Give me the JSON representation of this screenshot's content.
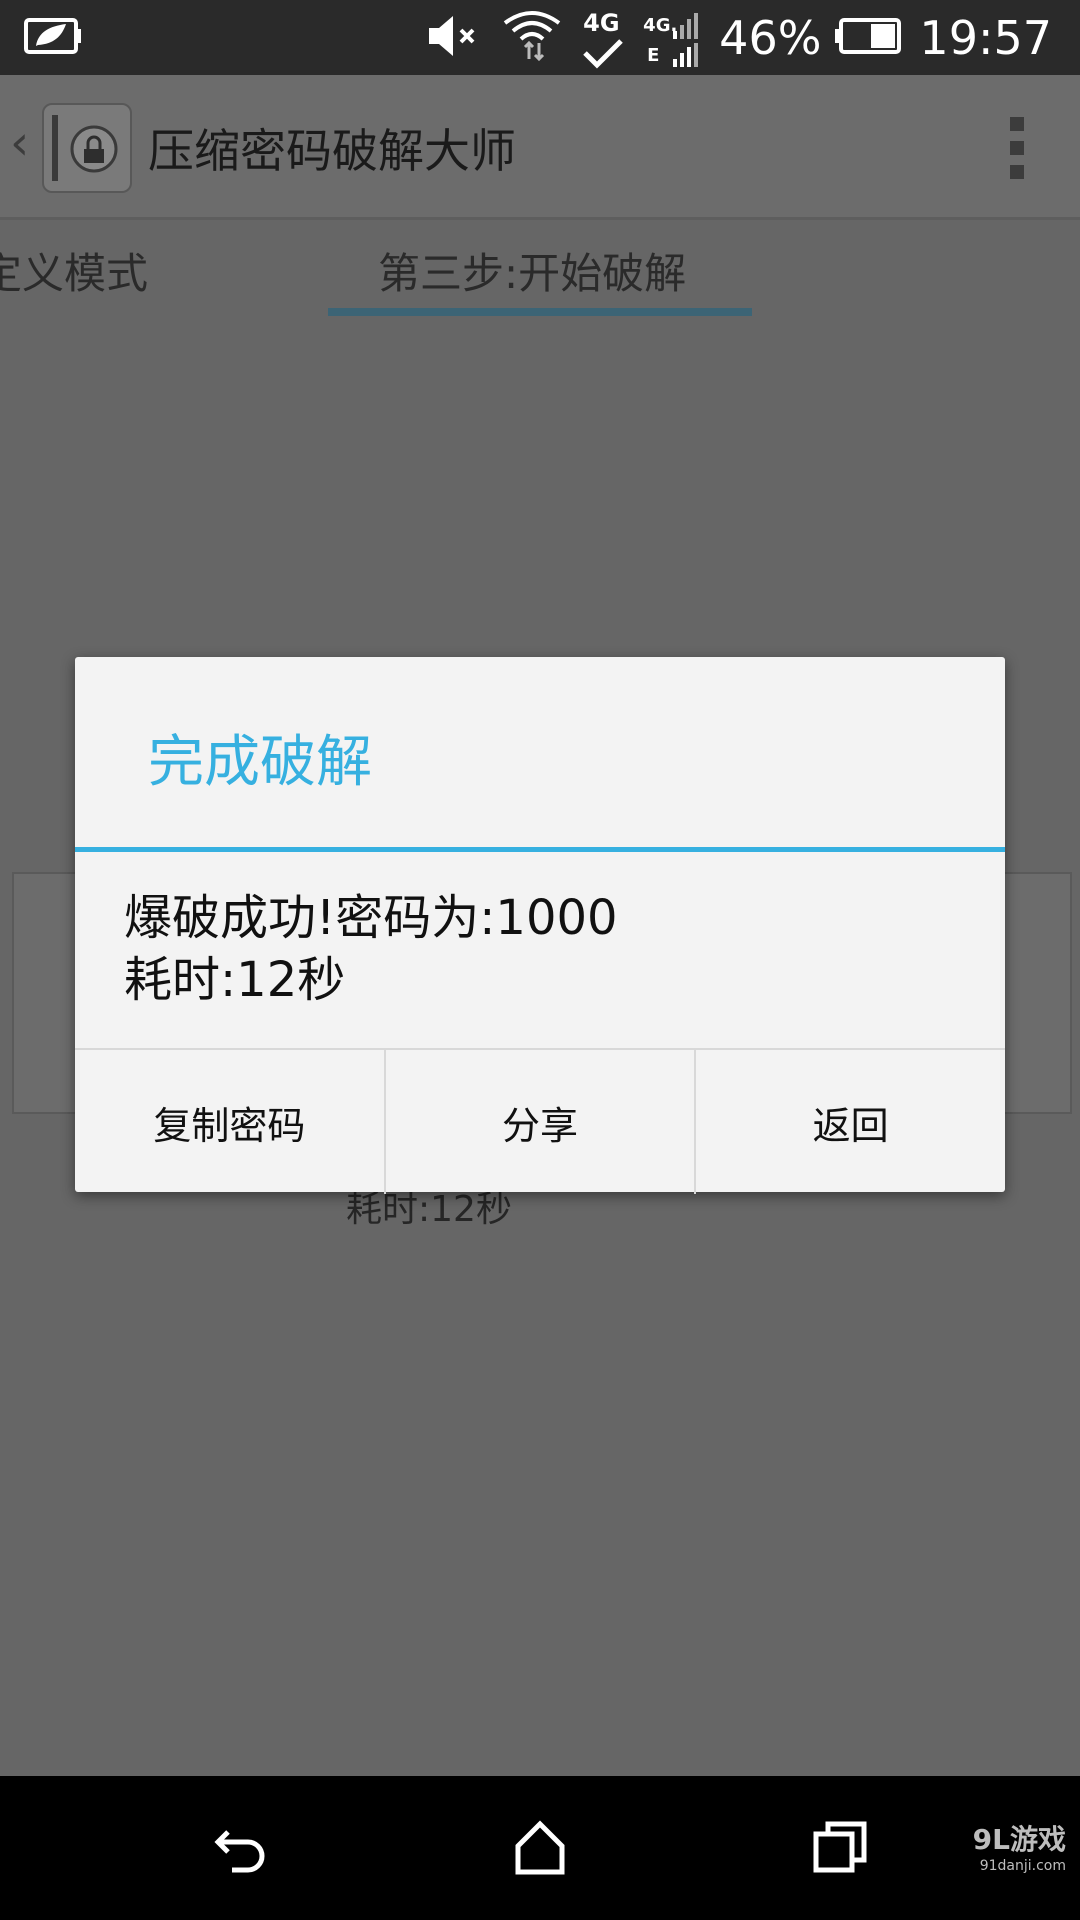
{
  "status_bar": {
    "battery_percent": "46%",
    "time": "19:57",
    "network_label": "4G",
    "network_sub_label": "4G.",
    "edge_label": "E"
  },
  "action_bar": {
    "app_title": "压缩密码破解大师"
  },
  "tabs": [
    {
      "label": "定义模式"
    },
    {
      "label": "第三步:开始破解"
    }
  ],
  "background": {
    "elapsed_text": "耗时:12秒"
  },
  "dialog": {
    "title": "完成破解",
    "message_line1": "爆破成功!密码为:1000",
    "message_line2": "耗时:12秒",
    "buttons": [
      {
        "label": "复制密码"
      },
      {
        "label": "分享"
      },
      {
        "label": "返回"
      }
    ]
  },
  "watermark": {
    "main": "9L游戏",
    "sub": "91danji.com"
  },
  "colors": {
    "accent": "#36b0e0",
    "dim_background": "#666666"
  }
}
